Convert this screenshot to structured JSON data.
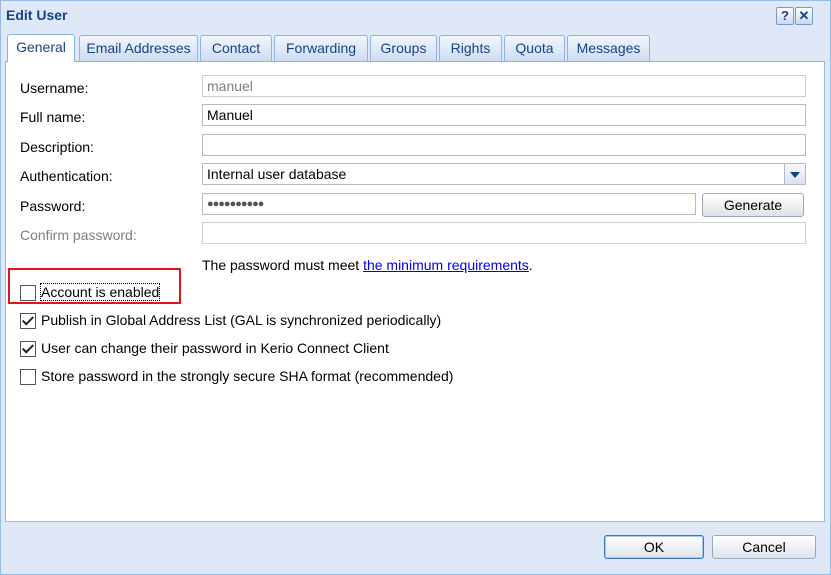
{
  "window": {
    "title": "Edit User",
    "help_symbol": "?",
    "close_symbol": "✕"
  },
  "tabs": [
    {
      "label": "General",
      "active": true
    },
    {
      "label": "Email Addresses"
    },
    {
      "label": "Contact"
    },
    {
      "label": "Forwarding"
    },
    {
      "label": "Groups"
    },
    {
      "label": "Rights"
    },
    {
      "label": "Quota"
    },
    {
      "label": "Messages"
    }
  ],
  "form": {
    "username_label": "Username:",
    "username_value": "manuel",
    "fullname_label": "Full name:",
    "fullname_value": "Manuel",
    "description_label": "Description:",
    "description_value": "",
    "auth_label": "Authentication:",
    "auth_value": "Internal user database",
    "password_label": "Password:",
    "password_value": "●●●●●●●●●●",
    "generate_label": "Generate",
    "confirm_label": "Confirm password:",
    "confirm_value": "",
    "hint_text": "The password must meet ",
    "hint_link": "the minimum requirements",
    "hint_end": "."
  },
  "checkboxes": [
    {
      "label": "Account is enabled",
      "checked": false
    },
    {
      "label": "Publish in Global Address List (GAL is synchronized periodically)",
      "checked": true
    },
    {
      "label": "User can change their password in Kerio Connect Client",
      "checked": true
    },
    {
      "label": "Store password in the strongly secure SHA format (recommended)",
      "checked": false
    }
  ],
  "footer": {
    "ok_label": "OK",
    "cancel_label": "Cancel"
  },
  "colors": {
    "title": "#15428b",
    "highlight": "#e0141e",
    "link": "#0000ee"
  }
}
